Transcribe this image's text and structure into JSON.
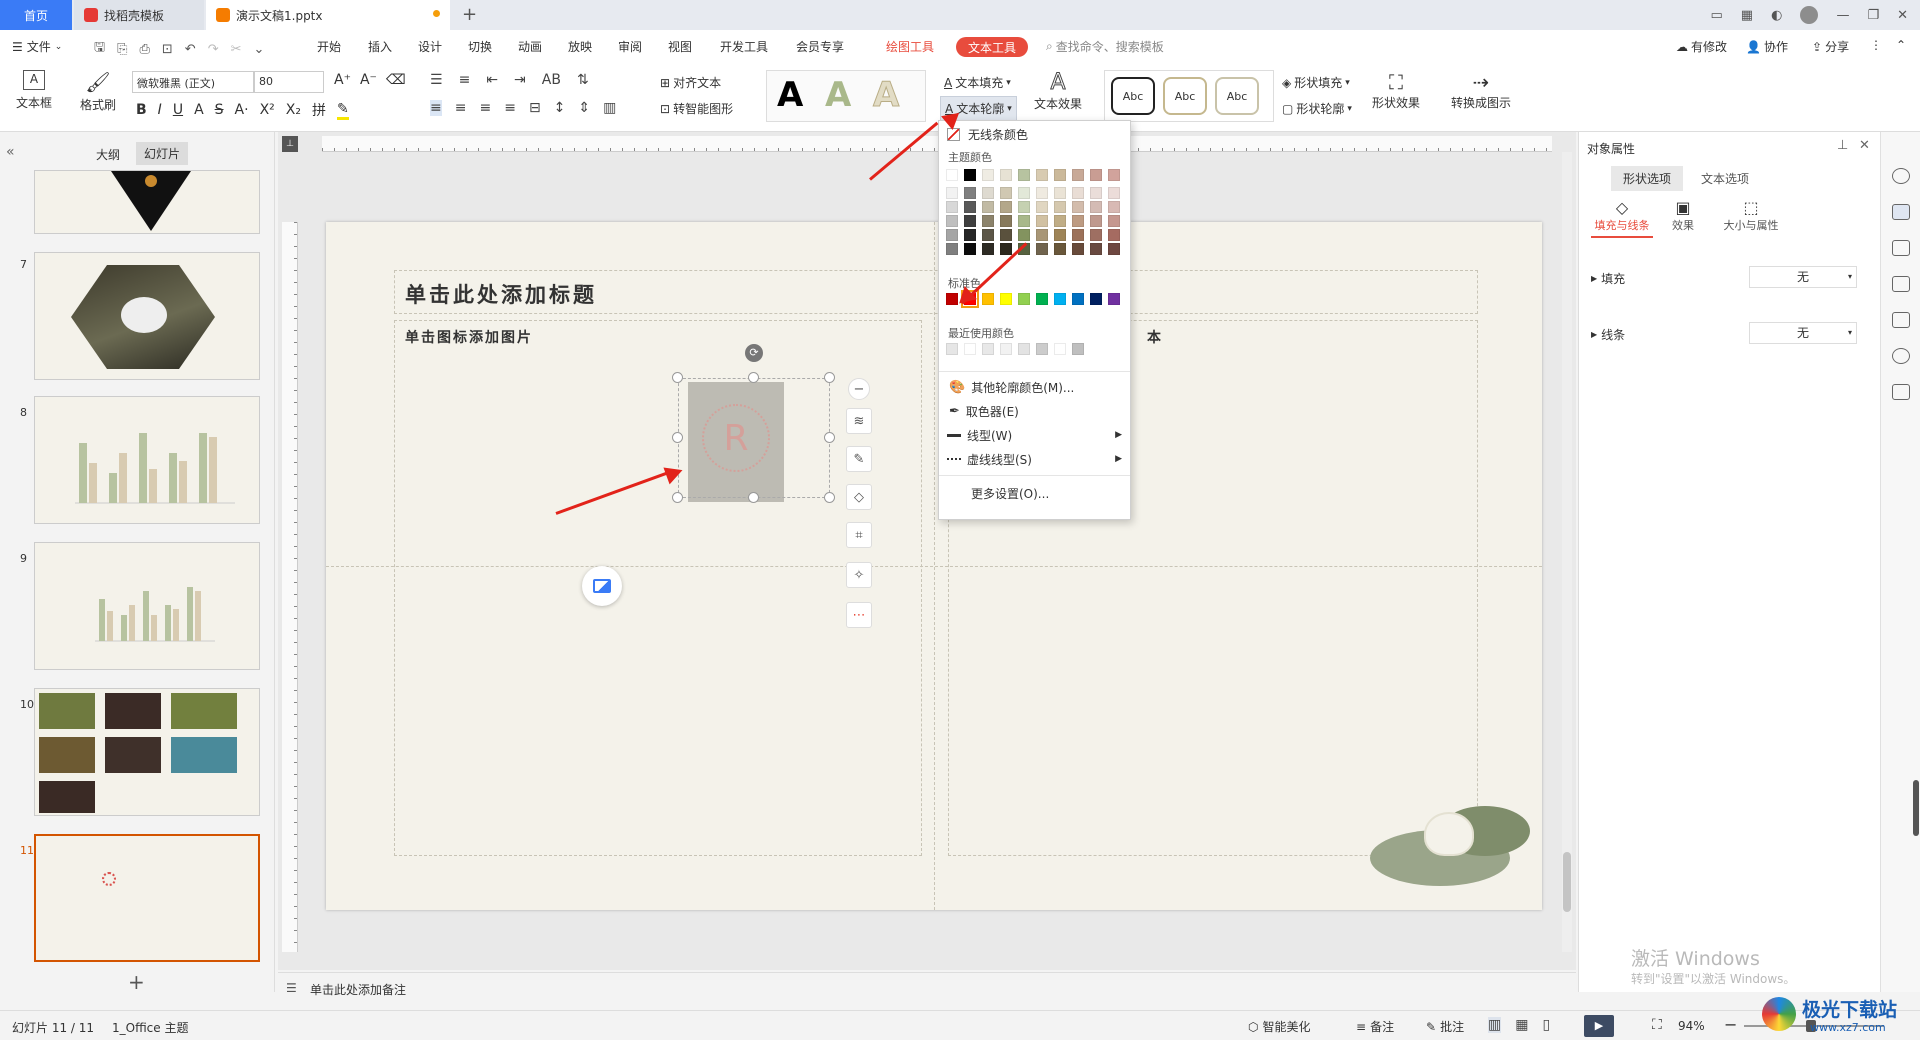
{
  "tabs": {
    "home": "首页",
    "template": "找稻壳模板",
    "doc": "演示文稿1.pptx"
  },
  "menu": {
    "file": "文件",
    "items": [
      "开始",
      "插入",
      "设计",
      "切换",
      "动画",
      "放映",
      "审阅",
      "视图",
      "开发工具",
      "会员专享"
    ],
    "draw_tools": "绘图工具",
    "text_tools": "文本工具",
    "search": "查找命令、搜索模板",
    "modified": "有修改",
    "collab": "协作",
    "share": "分享"
  },
  "ribbon": {
    "textbox": "文本框",
    "format_painter": "格式刷",
    "font_name": "微软雅黑 (正文)",
    "font_size": "80",
    "align_text": "对齐文本",
    "smart_shape": "转智能图形",
    "text_fill": "文本填充",
    "text_outline": "文本轮廓",
    "text_effect": "文本效果",
    "style_label": "Abc",
    "shape_fill": "形状填充",
    "shape_outline": "形状轮廓",
    "shape_effect": "形状效果",
    "convert_diagram": "转换成图示"
  },
  "left_panel": {
    "tab_outline": "大纲",
    "tab_slides": "幻灯片",
    "slides": [
      "7",
      "8",
      "9",
      "10",
      "11"
    ]
  },
  "slide": {
    "title_placeholder": "单击此处添加标题",
    "image_placeholder": "单击图标添加图片",
    "text_placeholder_tail": "本"
  },
  "dropdown": {
    "no_line": "无线条颜色",
    "theme_colors": "主题颜色",
    "standard_colors": "标准色",
    "recent_colors": "最近使用颜色",
    "more_colors": "其他轮廓颜色(M)...",
    "eyedropper": "取色器(E)",
    "line_type": "线型(W)",
    "dash_type": "虚线线型(S)",
    "more_settings": "更多设置(O)...",
    "theme_row": [
      "#ffffff",
      "#000000",
      "#efece3",
      "#e7e2d4",
      "#b7c3a0",
      "#d8cbb1",
      "#cbb99a",
      "#c8a997",
      "#c99d93",
      "#d1a39c"
    ],
    "theme_grid": [
      [
        "#f2f2f2",
        "#7f7f7f",
        "#dedad0",
        "#d0c8b2",
        "#e2e8d8",
        "#efeae0",
        "#eae3d6",
        "#e9ddd5",
        "#eaddd9",
        "#ecdcd9"
      ],
      [
        "#d8d8d8",
        "#595959",
        "#c1baa4",
        "#b3a78a",
        "#c5d1b1",
        "#e0d6c1",
        "#d5c8ae",
        "#d3bcac",
        "#d4bbb4",
        "#d8b9b4"
      ],
      [
        "#bfbfbf",
        "#3f3f3f",
        "#8c836b",
        "#877a5c",
        "#a8b88a",
        "#d1c1a2",
        "#c0ad86",
        "#bd9b82",
        "#bf998e",
        "#c5978f"
      ],
      [
        "#a5a5a5",
        "#262626",
        "#5c5647",
        "#5a513d",
        "#83935f",
        "#a89676",
        "#9e8457",
        "#9c7159",
        "#9e6f62",
        "#a56b61"
      ],
      [
        "#7f7f7f",
        "#0c0c0c",
        "#2e2b24",
        "#2d291e",
        "#57623f",
        "#70644e",
        "#69573a",
        "#684b3b",
        "#694a41",
        "#6e4741"
      ]
    ],
    "standard": [
      "#c00000",
      "#ff0000",
      "#ffc000",
      "#ffff00",
      "#92d050",
      "#00b050",
      "#00b0f0",
      "#0070c0",
      "#002060",
      "#7030a0"
    ],
    "recent": [
      "#e6e6e6",
      "#ffffff",
      "#e8e8e8",
      "#f2f2f2",
      "#e3e3e3",
      "#cccccc",
      "#ffffff",
      "#bfbfbf"
    ]
  },
  "right_pane": {
    "title": "对象属性",
    "tab_shape": "形状选项",
    "tab_text": "文本选项",
    "sub_fill_line": "填充与线条",
    "sub_effect": "效果",
    "sub_size": "大小与属性",
    "fill_label": "填充",
    "fill_value": "无",
    "line_label": "线条",
    "line_value": "无"
  },
  "notes": {
    "placeholder": "单击此处添加备注"
  },
  "status": {
    "slide_count": "幻灯片 11 / 11",
    "theme": "1_Office 主题",
    "smart_beautify": "智能美化",
    "notes": "备注",
    "comments": "批注",
    "zoom": "94%"
  },
  "watermark": {
    "activate": "激活 Windows",
    "activate_sub": "转到\"设置\"以激活 Windows。",
    "site": "极光下载站",
    "url": "www.xz7.com"
  },
  "colors": {
    "accent_blue": "#3a7bf6",
    "text_tools_red": "#e84c3d",
    "annotation_red": "#e2231a",
    "selected_slide": "#d35400"
  }
}
